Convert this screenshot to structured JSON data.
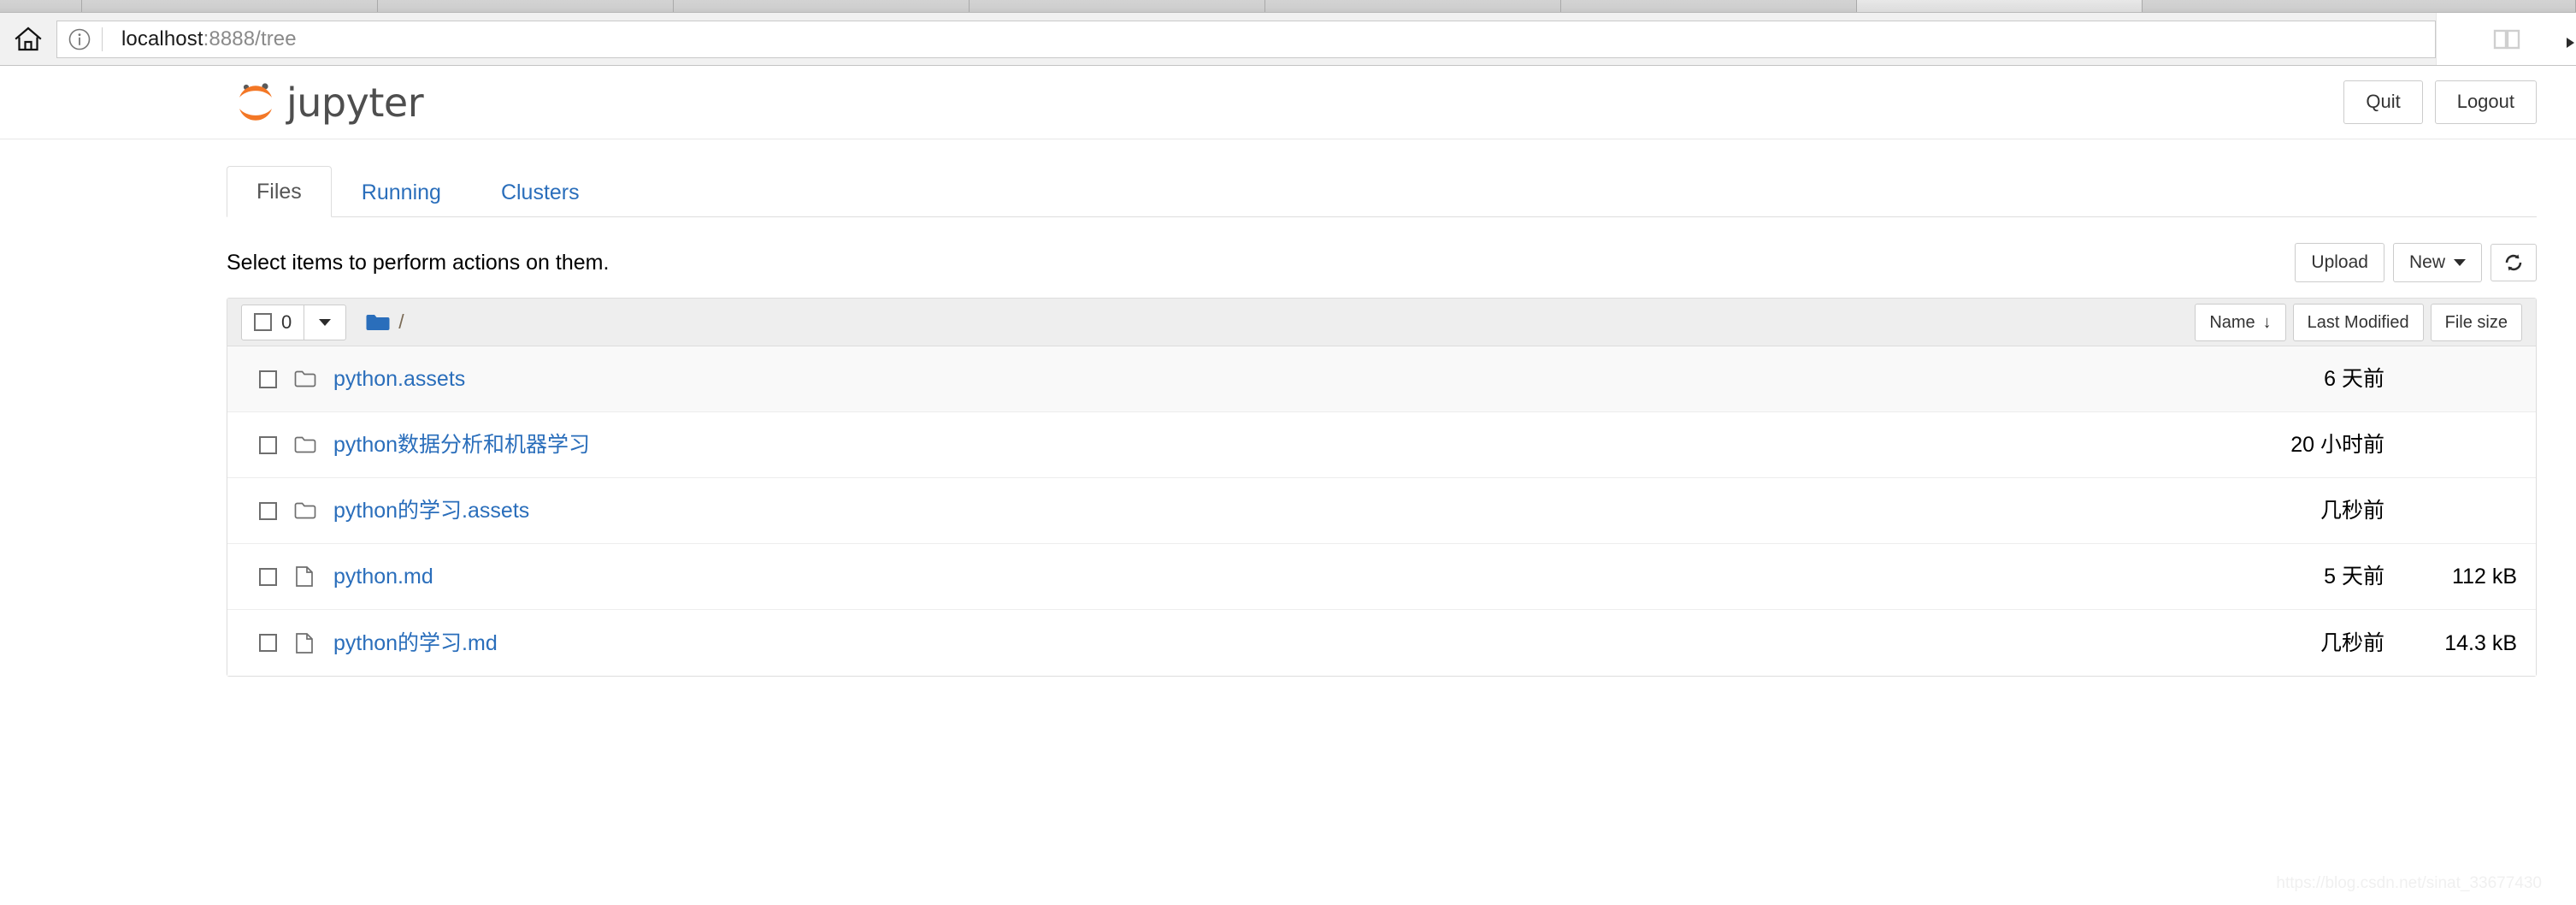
{
  "browser": {
    "home_icon": "home-icon",
    "info_icon": "info-circle-icon",
    "url_main": "localhost",
    "url_rest": ":8888/tree",
    "reading_list_icon": "book-icon",
    "overflow_icon": "chevron-right-icon"
  },
  "header": {
    "logo_text": "jupyter",
    "logo_icon": "jupyter-planet-logo",
    "quit_label": "Quit",
    "logout_label": "Logout"
  },
  "tabs": [
    {
      "label": "Files",
      "active": true
    },
    {
      "label": "Running",
      "active": false
    },
    {
      "label": "Clusters",
      "active": false
    }
  ],
  "toolbar": {
    "hint": "Select items to perform actions on them.",
    "upload_label": "Upload",
    "new_label": "New",
    "refresh_icon": "refresh-icon"
  },
  "filelist": {
    "select_count": "0",
    "breadcrumb_folder_icon": "folder-icon-blue",
    "breadcrumb_path": "/",
    "sort": {
      "name_label": "Name",
      "name_arrow": "↓",
      "modified_label": "Last Modified",
      "size_label": "File size"
    },
    "rows": [
      {
        "type": "folder",
        "name": "python.assets",
        "modified": "6 天前",
        "size": ""
      },
      {
        "type": "folder",
        "name": "python数据分析和机器学习",
        "modified": "20 小时前",
        "size": ""
      },
      {
        "type": "folder",
        "name": "python的学习.assets",
        "modified": "几秒前",
        "size": ""
      },
      {
        "type": "file",
        "name": "python.md",
        "modified": "5 天前",
        "size": "112 kB"
      },
      {
        "type": "file",
        "name": "python的学习.md",
        "modified": "几秒前",
        "size": "14.3 kB"
      }
    ]
  },
  "watermark": "https://blog.csdn.net/sinat_33677430",
  "colors": {
    "jupyter_orange": "#f37726",
    "link_blue": "#2a6ebb",
    "folder_blue": "#2a6ebb",
    "icon_gray": "#6e6e6e"
  }
}
